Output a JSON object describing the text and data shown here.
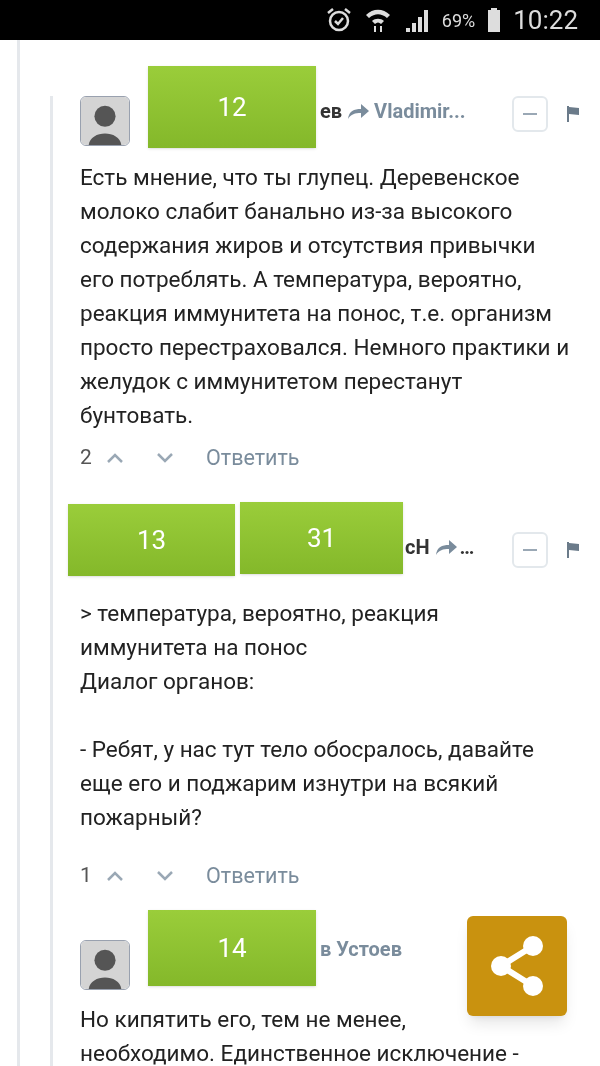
{
  "status_bar": {
    "battery": "69%",
    "time": "10:22"
  },
  "comments": [
    {
      "name_end": "ев",
      "reply_to": "Vladimir...",
      "collapse": true,
      "sticker": {
        "label": "12"
      },
      "body": [
        "Есть мнение, что ты глупец. Деревенское молоко слабит банально из-за высокого содержания жиров и отсутствия привычки его потреблять. А температура, вероятно, реакция иммунитета на понос, т.е. организм просто перестраховался. Немного практики и желудок с иммунитетом перестанут бунтовать."
      ],
      "score": "2",
      "reply": "Ответить"
    },
    {
      "name_end": "сН",
      "reply_to": "…",
      "collapse": true,
      "stickers": [
        {
          "label": "13"
        },
        {
          "label": "31"
        }
      ],
      "body": [
        "> температура, вероятно, реакция иммунитета на понос\nДиалог органов:",
        "- Ребят, у нас тут тело обосралось, давайте еще его и поджарим изнутри на всякий пожарный?"
      ],
      "score": "1",
      "reply": "Ответить"
    },
    {
      "reply_to": "в Устоев",
      "sticker": {
        "label": "14"
      },
      "body_lines": [
        "Но кипятить его, тем не менее,",
        "необходимо. Единственное исключение -"
      ]
    }
  ]
}
